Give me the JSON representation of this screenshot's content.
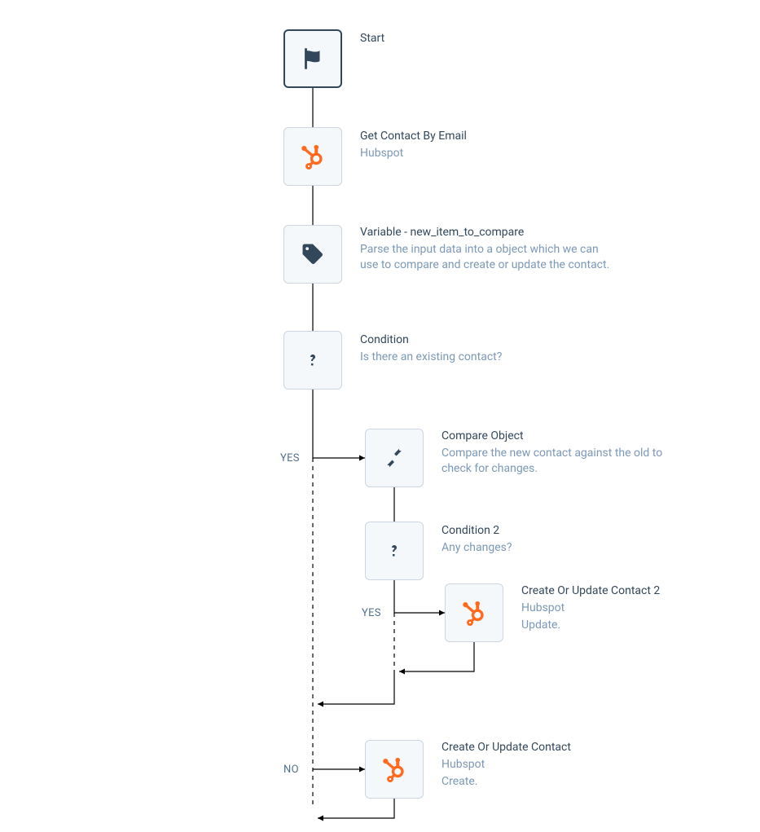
{
  "nodes": {
    "start": {
      "title": "Start"
    },
    "getContact": {
      "title": "Get Contact By Email",
      "sub": "Hubspot"
    },
    "variable": {
      "title": "Variable - new_item_to_compare",
      "sub": "Parse the input data into a object which we can use to compare and create or update the contact."
    },
    "condition1": {
      "title": "Condition",
      "sub": "Is there an existing contact?"
    },
    "compare": {
      "title": "Compare Object",
      "sub": "Compare the new contact against the old to check for changes."
    },
    "condition2": {
      "title": "Condition 2",
      "sub": "Any changes?"
    },
    "update": {
      "title": "Create Or Update Contact 2",
      "sub1": "Hubspot",
      "sub2": "Update."
    },
    "create": {
      "title": "Create Or Update Contact",
      "sub1": "Hubspot",
      "sub2": "Create."
    }
  },
  "branches": {
    "yes": "YES",
    "no": "NO",
    "yes2": "YES"
  }
}
